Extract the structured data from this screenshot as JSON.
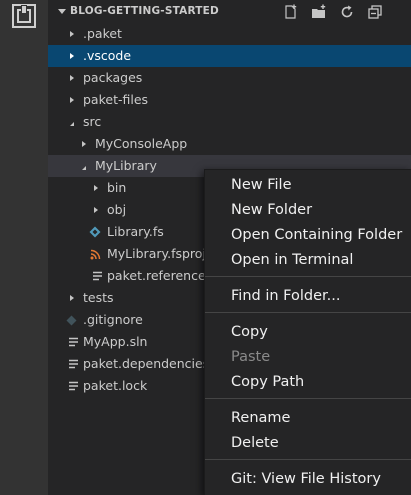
{
  "explorer": {
    "section_title": "BLOG-GETTING-STARTED",
    "header_actions": [
      "new-file-icon",
      "new-folder-icon",
      "refresh-icon",
      "collapse-all-icon"
    ]
  },
  "tree": [
    {
      "label": ".paket",
      "type": "folder",
      "expanded": false,
      "depth": 0
    },
    {
      "label": ".vscode",
      "type": "folder",
      "expanded": false,
      "depth": 0,
      "selected": true
    },
    {
      "label": "packages",
      "type": "folder",
      "expanded": false,
      "depth": 0
    },
    {
      "label": "paket-files",
      "type": "folder",
      "expanded": false,
      "depth": 0
    },
    {
      "label": "src",
      "type": "folder",
      "expanded": true,
      "depth": 0
    },
    {
      "label": "MyConsoleApp",
      "type": "folder",
      "expanded": false,
      "depth": 1
    },
    {
      "label": "MyLibrary",
      "type": "folder",
      "expanded": true,
      "depth": 1,
      "focused": true
    },
    {
      "label": "bin",
      "type": "folder",
      "expanded": false,
      "depth": 2
    },
    {
      "label": "obj",
      "type": "folder",
      "expanded": false,
      "depth": 2
    },
    {
      "label": "Library.fs",
      "type": "file",
      "icon": "fsharp-file-icon",
      "depth": 2
    },
    {
      "label": "MyLibrary.fsproj",
      "type": "file",
      "icon": "rss-file-icon",
      "depth": 2
    },
    {
      "label": "paket.references",
      "type": "file",
      "icon": "text-file-icon",
      "depth": 2
    },
    {
      "label": "tests",
      "type": "folder",
      "expanded": false,
      "depth": 0
    },
    {
      "label": ".gitignore",
      "type": "file",
      "icon": "git-file-icon",
      "depth": 0
    },
    {
      "label": "MyApp.sln",
      "type": "file",
      "icon": "text-file-icon",
      "depth": 0
    },
    {
      "label": "paket.dependencies",
      "type": "file",
      "icon": "text-file-icon",
      "depth": 0
    },
    {
      "label": "paket.lock",
      "type": "file",
      "icon": "text-file-icon",
      "depth": 0
    }
  ],
  "context_menu": {
    "items": [
      {
        "label": "New File",
        "enabled": true
      },
      {
        "label": "New Folder",
        "enabled": true
      },
      {
        "label": "Open Containing Folder",
        "enabled": true
      },
      {
        "label": "Open in Terminal",
        "enabled": true
      },
      {
        "separator": true
      },
      {
        "label": "Find in Folder...",
        "enabled": true
      },
      {
        "separator": true
      },
      {
        "label": "Copy",
        "enabled": true
      },
      {
        "label": "Paste",
        "enabled": false
      },
      {
        "label": "Copy Path",
        "enabled": true
      },
      {
        "separator": true
      },
      {
        "label": "Rename",
        "enabled": true
      },
      {
        "label": "Delete",
        "enabled": true
      },
      {
        "separator": true
      },
      {
        "label": "Git: View File History",
        "enabled": true
      }
    ]
  },
  "colors": {
    "selected_row": "#094771",
    "fsharp_icon": "#519aba",
    "rss_icon": "#e37933"
  }
}
